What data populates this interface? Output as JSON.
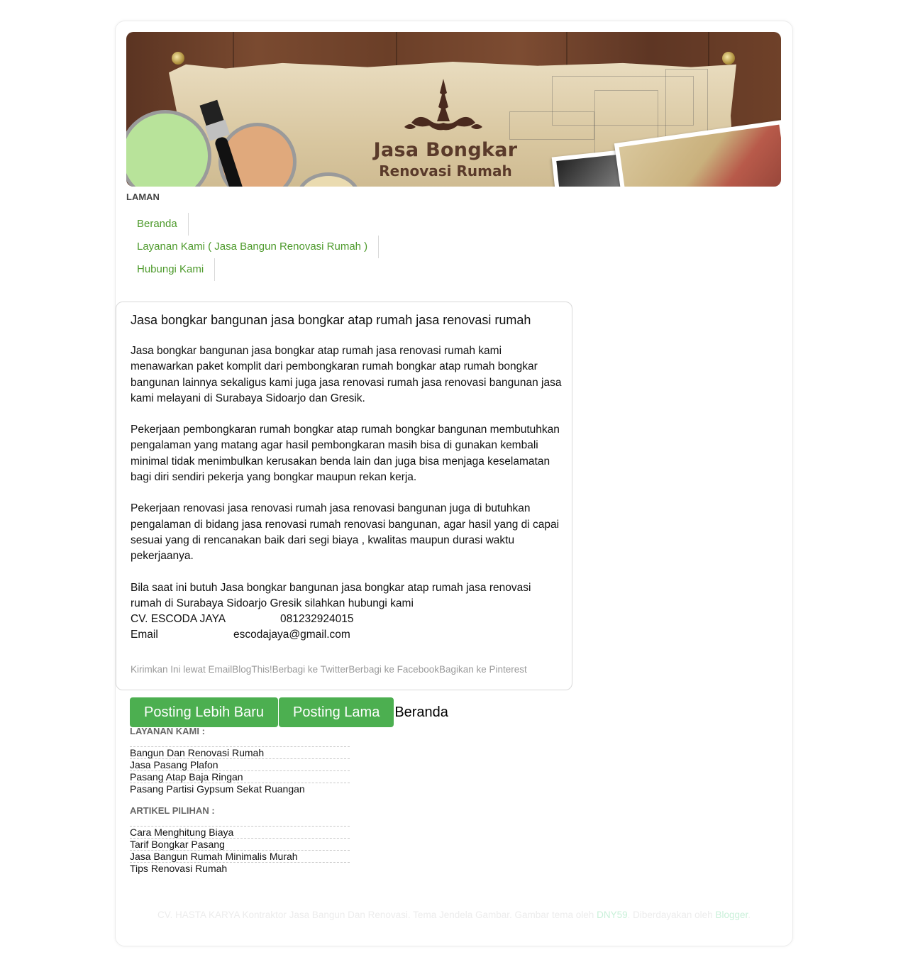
{
  "header": {
    "title": "Jasa Bongkar",
    "subtitle": "Renovasi Rumah"
  },
  "nav": {
    "title": "LAMAN",
    "items": [
      {
        "label": "Beranda"
      },
      {
        "label": "Layanan Kami ( Jasa Bangun Renovasi Rumah )"
      },
      {
        "label": "Hubungi Kami"
      }
    ]
  },
  "post": {
    "title": "Jasa bongkar bangunan jasa bongkar atap rumah jasa renovasi rumah",
    "paragraphs": [
      "Jasa bongkar bangunan jasa bongkar atap rumah jasa renovasi rumah kami menawarkan paket komplit dari pembongkaran rumah bongkar atap rumah bongkar bangunan lainnya sekaligus kami juga jasa renovasi rumah jasa renovasi bangunan jasa kami melayani di Surabaya Sidoarjo dan Gresik.",
      "Pekerjaan pembongkaran rumah bongkar atap rumah bongkar bangunan membutuhkan pengalaman yang matang agar hasil pembongkaran masih bisa di gunakan kembali minimal tidak menimbulkan kerusakan benda lain dan juga bisa menjaga keselamatan bagi diri sendiri pekerja yang bongkar maupun rekan kerja.",
      "Pekerjaan renovasi jasa renovasi rumah jasa renovasi bangunan juga di butuhkan pengalaman di bidang jasa renovasi rumah renovasi bangunan, agar hasil yang di capai sesuai yang di rencanakan baik dari segi biaya , kwalitas maupun durasi waktu pekerjaanya.",
      "Bila saat ini butuh Jasa bongkar bangunan jasa bongkar atap rumah jasa renovasi rumah di Surabaya Sidoarjo Gresik silahkan hubungi kami"
    ],
    "company": "CV. ESCODA JAYA",
    "phone": "081232924015",
    "email_label": "Email",
    "email": "escodajaya@gmail.com",
    "share": [
      "Kirimkan Ini lewat Email",
      "BlogThis!",
      "Berbagi ke Twitter",
      "Berbagi ke Facebook",
      "Bagikan ke Pinterest"
    ]
  },
  "pager": {
    "newer": "Posting Lebih Baru",
    "older": "Posting Lama",
    "home": "Beranda"
  },
  "widgets": {
    "layanan": {
      "title": "LAYANAN KAMI :",
      "items": [
        "Bangun Dan Renovasi Rumah",
        "Jasa Pasang Plafon",
        "Pasang Atap Baja Ringan",
        "Pasang Partisi Gypsum Sekat Ruangan"
      ]
    },
    "artikel": {
      "title": "ARTIKEL PILIHAN :",
      "items": [
        "Cara Menghitung Biaya",
        "Tarif Bongkar Pasang",
        "Jasa Bangun Rumah Minimalis Murah",
        "Tips Renovasi Rumah"
      ]
    }
  },
  "footer": {
    "text1": "CV. HASTA KARYA Kontraktor Jasa Bangun Dan Renovasi. Tema Jendela Gambar. Gambar tema oleh ",
    "link1": "DNY59",
    "text2": ". Diberdayakan oleh ",
    "link2": "Blogger",
    "text3": "."
  },
  "colors": {
    "link_green": "#4d9a2b",
    "button_green": "#4caf50"
  }
}
